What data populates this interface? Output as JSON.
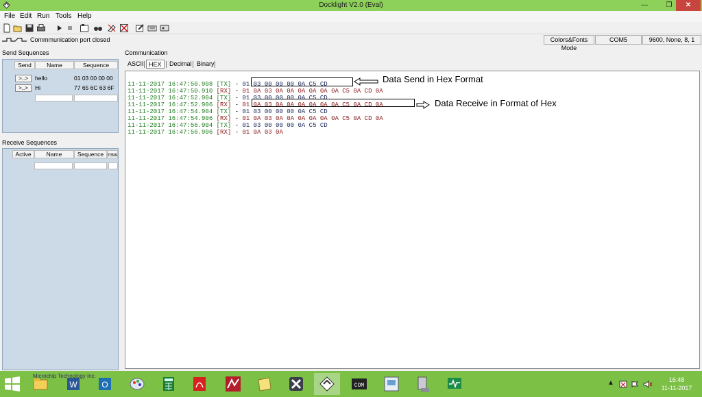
{
  "window": {
    "title": "Docklight V2.0 (Eval)",
    "min_glyph": "—",
    "max_glyph": "❐",
    "close_glyph": "✕"
  },
  "menu": [
    "File",
    "Edit",
    "Run",
    "Tools",
    "Help"
  ],
  "toolbar_icons": [
    "new-icon",
    "open-icon",
    "save-icon",
    "print-icon",
    "play-icon",
    "stop-icon",
    "settings-icon",
    "find-icon",
    "clear-icon",
    "edit-icon",
    "keyboard-icon",
    "script-icon"
  ],
  "status": {
    "message": "Commmunication port closed",
    "colors_fonts": "Colors&Fonts Mode",
    "port": "COM5",
    "settings": "9600, None, 8, 1"
  },
  "send_sequences": {
    "title": "Send Sequences",
    "headers": [
      "Send",
      "Name",
      "Sequence"
    ],
    "button_label": ">..>",
    "rows": [
      {
        "name": "hello",
        "sequence": "01 03 00 00 00"
      },
      {
        "name": "Hi",
        "sequence": "77 65 6C 63 6F"
      }
    ]
  },
  "receive_sequences": {
    "title": "Receive Sequences",
    "headers": [
      "Active",
      "Name",
      "Sequence",
      "nsw"
    ]
  },
  "communication": {
    "title": "Communication",
    "tabs": [
      "ASCII",
      "HEX",
      "Decimal",
      "Binary"
    ],
    "active_tab": "HEX",
    "log": [
      {
        "ts": "11-11-2017 16:47:50.908",
        "dir": "[TX]",
        "data": "01 03 00 00 00 0A C5 CD"
      },
      {
        "ts": "11-11-2017 16:47:50.910",
        "dir": "[RX]",
        "data": "01 0A 03 0A 0A 0A 0A 0A 0A C5 0A CD 0A"
      },
      {
        "ts": "11-11-2017 16:47:52.904",
        "dir": "[TX]",
        "data": "01 03 00 00 00 0A C5 CD"
      },
      {
        "ts": "11-11-2017 16:47:52.906",
        "dir": "[RX]",
        "data": "01 0A 03 0A 0A 0A 0A 0A 0A C5 0A CD 0A"
      },
      {
        "ts": "11-11-2017 16:47:54.904",
        "dir": "[TX]",
        "data": "01 03 00 00 00 0A C5 CD"
      },
      {
        "ts": "11-11-2017 16:47:54.906",
        "dir": "[RX]",
        "data": "01 0A 03 0A 0A 0A 0A 0A 0A C5 0A CD 0A"
      },
      {
        "ts": "11-11-2017 16:47:56.904",
        "dir": "[TX]",
        "data": "01 03 00 00 00 0A C5 CD"
      },
      {
        "ts": "11-11-2017 16:47:56.906",
        "dir": "[RX]",
        "data": "01 0A 03 0A"
      }
    ],
    "annotations": {
      "send": "Data Send in Hex Format",
      "receive": "Data Receive in Format of Hex"
    }
  },
  "taskbar": {
    "caption": "Microchip Technology Inc.",
    "apps": [
      "file-explorer-icon",
      "word-icon",
      "outlook-icon",
      "paint-icon",
      "calculator-icon",
      "pdf-icon",
      "mplab-icon",
      "notes-icon",
      "xmind-icon",
      "docklight-icon",
      "terminal-icon",
      "viewer-icon",
      "control-panel-icon",
      "monitor-icon"
    ],
    "clock_time": "16:48",
    "clock_date": "11-11-2017"
  },
  "colors": {
    "accent_green": "#8ed15a",
    "taskbar_green": "#7cc046",
    "panel_blue": "#ccd9e6",
    "tx_green": "#1e7d1e",
    "rx_red": "#8b1a1a"
  }
}
